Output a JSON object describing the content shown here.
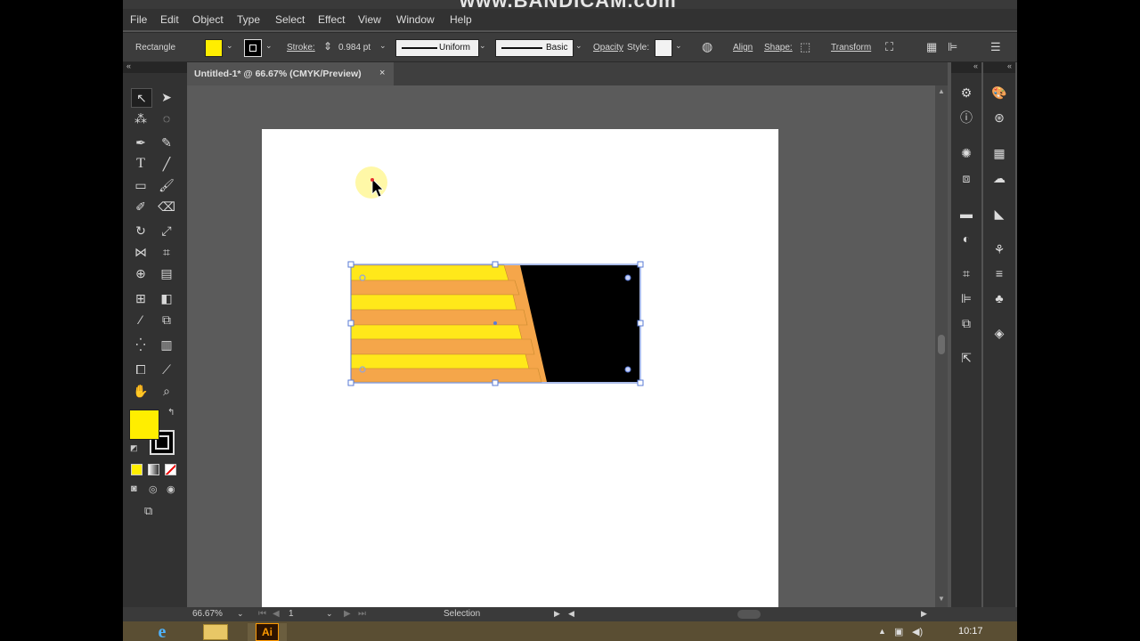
{
  "watermark": "www.BANDICAM.com",
  "menu": [
    "File",
    "Edit",
    "Object",
    "Type",
    "Select",
    "Effect",
    "View",
    "Window",
    "Help"
  ],
  "control_bar": {
    "selection_type": "Rectangle",
    "stroke_label": "Stroke:",
    "stroke_weight": "0.984 pt",
    "profile_label": "Uniform",
    "brush_label": "Basic",
    "opacity_label": "Opacity",
    "style_label": "Style:",
    "align_label": "Align",
    "shape_label": "Shape:",
    "transform_label": "Transform"
  },
  "document_tab": {
    "title": "Untitled-1* @ 66.67% (CMYK/Preview)",
    "close": "×"
  },
  "status_bar": {
    "zoom": "66.67%",
    "artboard_number": "1",
    "tool_name": "Selection"
  },
  "taskbar": {
    "time": "10:17",
    "illustrator_label": "Ai"
  },
  "colors": {
    "fill": "#ffee00",
    "stroke": "#000000",
    "yellow_stripe": "#ffe81a",
    "orange_stripe": "#f5a64a",
    "black_panel": "#000000",
    "selection": "#5a7bd6"
  }
}
